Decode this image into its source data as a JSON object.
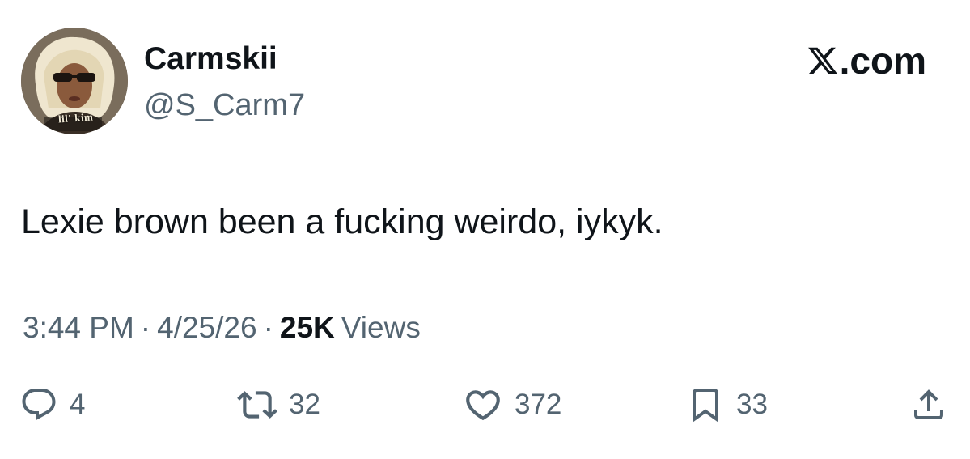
{
  "header": {
    "display_name": "Carmskii",
    "handle": "@S_Carm7",
    "brand": ".com",
    "brand_logo_icon": "x-logo-icon",
    "avatar_caption": "lil' kim"
  },
  "tweet": {
    "text": "Lexie brown been a fucking weirdo, iykyk."
  },
  "meta": {
    "time": "3:44 PM",
    "separator": "·",
    "date": "4/25/26",
    "views_count": "25K",
    "views_label": "Views"
  },
  "actions": {
    "reply": {
      "icon": "reply-icon",
      "count": "4"
    },
    "retweet": {
      "icon": "retweet-icon",
      "count": "32"
    },
    "like": {
      "icon": "heart-icon",
      "count": "372"
    },
    "bookmark": {
      "icon": "bookmark-icon",
      "count": "33"
    },
    "share": {
      "icon": "share-icon"
    }
  },
  "colors": {
    "text_primary": "#0f1419",
    "text_secondary": "#536471",
    "background": "#ffffff"
  }
}
